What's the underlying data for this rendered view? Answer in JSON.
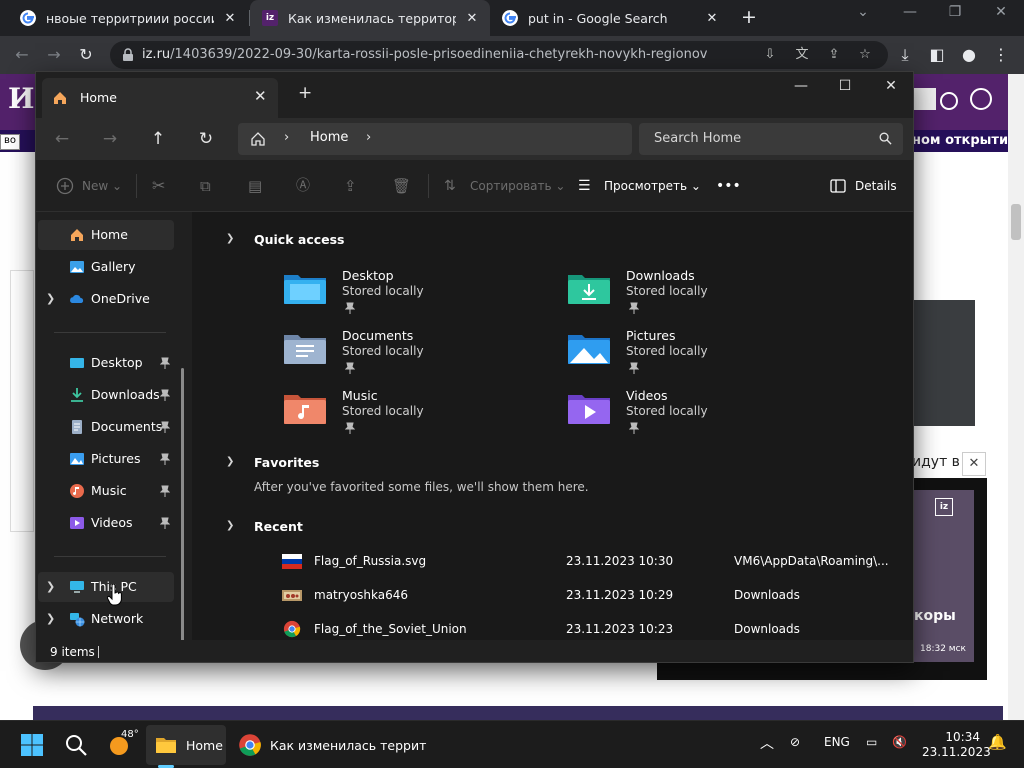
{
  "chrome": {
    "tabs": [
      {
        "title": "нвоые территриии россии - G",
        "favicon_color": "#ffffff"
      },
      {
        "title": "Как изменилась территория Р",
        "favicon_color": "#53226b"
      },
      {
        "title": "put in - Google Search",
        "favicon_color": "#ffffff"
      }
    ],
    "url_domain": "iz.ru",
    "url_path": "/1403639/2022-09-30/karta-rossii-posle-prisoedineniia-chetyrekh-novykh-regionov"
  },
  "web": {
    "logo": "ИЗ",
    "ticker": "ном открыти",
    "left_label": "во",
    "popup_text": "идут в",
    "video_logo": "iz",
    "video_caption": "коры",
    "video_time": "18:32 мск"
  },
  "explorer": {
    "tab_title": "Home",
    "address": "Home",
    "search_placeholder": "Search Home",
    "toolbar": {
      "new_label": "New",
      "sort_label": "Сортировать",
      "view_label": "Просмотреть",
      "more_label": "•••",
      "details_label": "Details"
    },
    "sidebar": [
      {
        "label": "Home",
        "icon": "home-icon"
      },
      {
        "label": "Gallery",
        "icon": "gallery-icon"
      },
      {
        "label": "OneDrive",
        "icon": "onedrive-icon"
      },
      {
        "label": "Desktop",
        "icon": "desktop-icon"
      },
      {
        "label": "Downloads",
        "icon": "downloads-icon"
      },
      {
        "label": "Documents",
        "icon": "documents-icon"
      },
      {
        "label": "Pictures",
        "icon": "pictures-icon"
      },
      {
        "label": "Music",
        "icon": "music-icon"
      },
      {
        "label": "Videos",
        "icon": "videos-icon"
      },
      {
        "label": "This PC",
        "icon": "this-pc-icon"
      },
      {
        "label": "Network",
        "icon": "network-icon"
      }
    ],
    "sections": {
      "quick_access": "Quick access",
      "favorites": "Favorites",
      "recent": "Recent"
    },
    "quick_access": [
      {
        "name": "Desktop",
        "sub": "Stored locally"
      },
      {
        "name": "Downloads",
        "sub": "Stored locally"
      },
      {
        "name": "Documents",
        "sub": "Stored locally"
      },
      {
        "name": "Pictures",
        "sub": "Stored locally"
      },
      {
        "name": "Music",
        "sub": "Stored locally"
      },
      {
        "name": "Videos",
        "sub": "Stored locally"
      }
    ],
    "favorites_note": "After you've favorited some files, we'll show them here.",
    "recent": [
      {
        "name": "Flag_of_Russia.svg",
        "date": "23.11.2023 10:30",
        "location": "VM6\\AppData\\Roaming\\..."
      },
      {
        "name": "matryoshka646",
        "date": "23.11.2023 10:29",
        "location": "Downloads"
      },
      {
        "name": "Flag_of_the_Soviet_Union",
        "date": "23.11.2023 10:23",
        "location": "Downloads"
      }
    ],
    "status": "9 items"
  },
  "taskbar": {
    "weather_temp": "48°",
    "explorer_label": "Home",
    "chrome_label": "Как изменилась террит",
    "lang": "ENG",
    "time": "10:34",
    "date": "23.11.2023"
  }
}
